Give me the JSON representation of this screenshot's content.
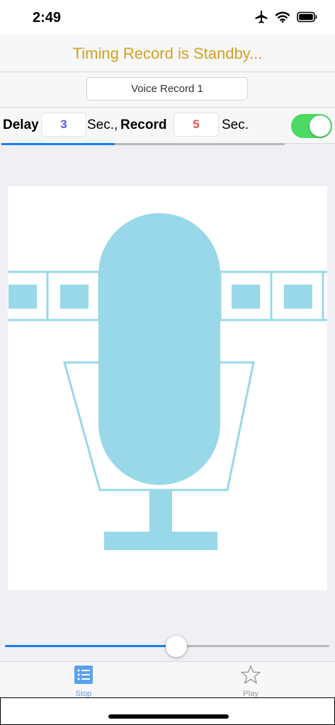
{
  "status_bar": {
    "time": "2:49",
    "icons": [
      "airplane-icon",
      "wifi-icon",
      "battery-icon"
    ]
  },
  "header": {
    "title": "Timing Record is Standby..."
  },
  "record_name": {
    "value": "Voice Record 1"
  },
  "timing": {
    "delay_label": "Delay",
    "delay_value": "3",
    "delay_unit": "Sec.,",
    "record_label": "Record",
    "record_value": "5",
    "record_unit": "Sec.",
    "toggle_on": true
  },
  "progress": {
    "fraction": 0.4
  },
  "microphone": {
    "icon": "microphone-icon"
  },
  "slider": {
    "fraction": 0.528
  },
  "tab_bar": {
    "tabs": [
      {
        "label": "Stop",
        "icon": "list-icon",
        "active": true
      },
      {
        "label": "Play",
        "icon": "star-icon",
        "active": false
      }
    ]
  },
  "colors": {
    "title": "#d4a020",
    "delay_value": "#5a5ae0",
    "record_value": "#e05a5a",
    "toggle_on": "#4cd964",
    "accent": "#1a7cf5",
    "mic": "#98d8e8",
    "tab_active": "#5aa0f0",
    "tab_inactive": "#9a9a9a"
  }
}
